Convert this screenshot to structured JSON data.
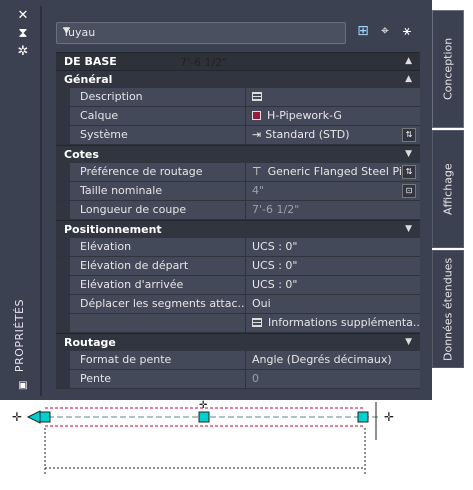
{
  "window": {
    "vertical_title": "PROPRIÉTÉS",
    "strip_icons": [
      "close-icon",
      "auto-hide-icon",
      "settings-icon"
    ]
  },
  "toolbar": {
    "object_type": "Tuyau",
    "icons": [
      "add-selection-icon",
      "select-objects-icon",
      "quick-select-icon"
    ]
  },
  "tabs": [
    {
      "label": "Conception",
      "active": true
    },
    {
      "label": "Affichage",
      "active": false
    },
    {
      "label": "Données étendues",
      "active": false
    }
  ],
  "grid": {
    "top_section": "DE BASE",
    "sections": [
      {
        "title": "Général",
        "rows": [
          {
            "key": "Description",
            "value": ""
          },
          {
            "key": "Calque",
            "value": "H-Pipework-G"
          },
          {
            "key": "Système",
            "value": "Standard (STD)"
          }
        ]
      },
      {
        "title": "Cotes",
        "rows": [
          {
            "key": "Préférence de routage",
            "value": "Generic Flanged Steel Pip"
          },
          {
            "key": "Taille nominale",
            "value": "4\""
          },
          {
            "key": "Longueur de coupe",
            "value": "7'-6 1/2\""
          }
        ]
      },
      {
        "title": "Positionnement",
        "rows": [
          {
            "key": "Elévation",
            "value": "UCS : 0\""
          },
          {
            "key": "Elévation de départ",
            "value": "UCS : 0\""
          },
          {
            "key": "Elévation d'arrivée",
            "value": "UCS : 0\""
          },
          {
            "key": "Déplacer les segments attac...",
            "value": "Oui"
          },
          {
            "key": "",
            "value": "Informations supplémenta..."
          }
        ]
      },
      {
        "title": "Routage",
        "rows": [
          {
            "key": "Format de pente",
            "value": "Angle (Degrés décimaux)"
          },
          {
            "key": "Pente",
            "value": "0"
          }
        ]
      }
    ]
  },
  "drawing": {
    "dimension_text": "7'-6 1/2\"",
    "colors": {
      "pipe_line": "#d0003a",
      "grip": "#00d0d0"
    }
  }
}
